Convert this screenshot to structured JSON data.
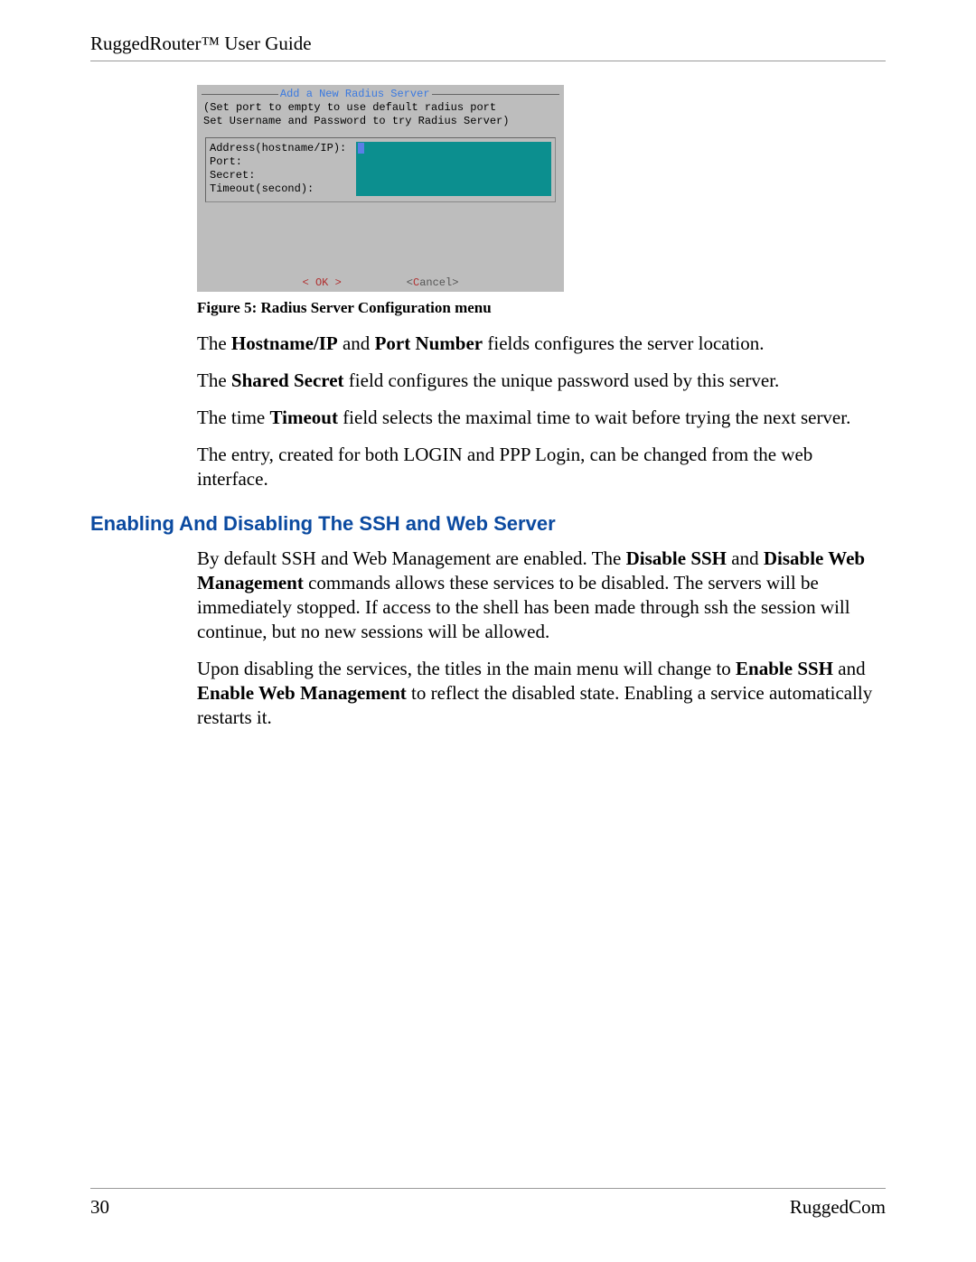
{
  "header": {
    "title": "RuggedRouter™ User Guide"
  },
  "terminal": {
    "title": "Add a New Radius Server",
    "hint1": "(Set port to empty to use default radius port",
    "hint2": "Set Username and Password to try Radius Server)",
    "fields": {
      "address": "Address(hostname/IP):",
      "port": "Port:",
      "secret": "Secret:",
      "timeout": "Timeout(second):"
    },
    "buttons": {
      "ok_open": "<  ",
      "ok": "OK",
      "ok_close": "  >",
      "cancel_open": "<",
      "cancel_c": "C",
      "cancel_rest": "ancel>",
      "spacer": "          "
    }
  },
  "caption": "Figure 5: Radius Server Configuration menu",
  "paragraphs": {
    "p1_a": "The ",
    "p1_b1": "Hostname/IP",
    "p1_c": " and ",
    "p1_b2": "Port Number",
    "p1_d": " fields configures the server location.",
    "p2_a": "The ",
    "p2_b1": "Shared Secret",
    "p2_c": " field configures the unique password used by this server.",
    "p3_a": "The time ",
    "p3_b1": "Timeout",
    "p3_c": " field selects the maximal time to wait before trying the next server.",
    "p4": "The entry, created for both LOGIN and PPP Login, can be changed from the web interface."
  },
  "section_heading": "Enabling And Disabling The SSH and Web Server",
  "section_paragraphs": {
    "s1_a": "By default SSH and Web Management are enabled.  The ",
    "s1_b1": "Disable SSH",
    "s1_c": " and ",
    "s1_b2": "Disable Web Management",
    "s1_d": " commands allows these services to be disabled.  The servers will be immediately stopped.  If access to the shell has been made through ssh the session will continue, but no new sessions will be allowed.",
    "s2_a": "Upon disabling the services, the titles in the main menu will change to ",
    "s2_b1": "Enable SSH",
    "s2_c": " and ",
    "s2_b2": "Enable Web Management",
    "s2_d": " to reflect the disabled state.  Enabling a service automatically restarts it."
  },
  "footer": {
    "page": "30",
    "brand": "RuggedCom"
  }
}
